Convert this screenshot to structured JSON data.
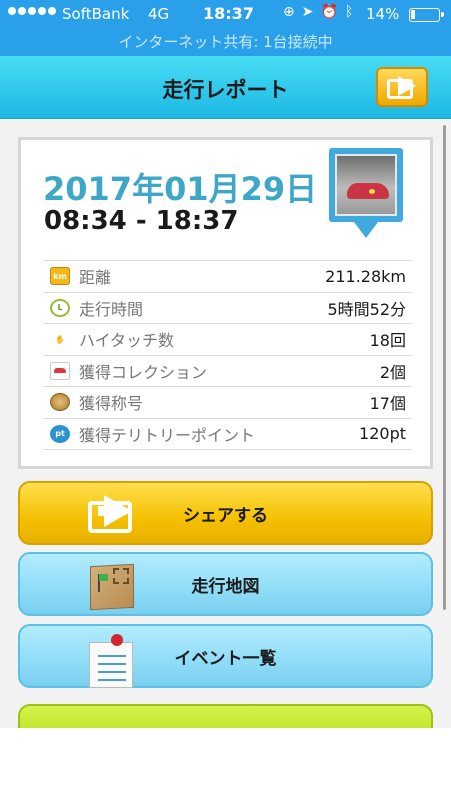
{
  "status_bar": {
    "carrier": "SoftBank",
    "network": "4G",
    "time": "18:37",
    "battery": "14%",
    "icons": [
      "orientation-lock-icon",
      "location-arrow-icon",
      "alarm-icon",
      "bluetooth-icon",
      "battery-icon"
    ]
  },
  "hotspot_banner": "インターネット共有: 1台接続中",
  "header": {
    "title": "走行レポート",
    "share_icon": "share-icon"
  },
  "report": {
    "date": "2017年01月29日",
    "time_range": "08:34 - 18:37",
    "stats": [
      {
        "icon": "km-icon",
        "icon_text": "km",
        "label": "距離",
        "value": "211.28km"
      },
      {
        "icon": "clock-icon",
        "icon_text": "L",
        "label": "走行時間",
        "value": "5時間52分"
      },
      {
        "icon": "high-touch-hand-icon",
        "icon_text": "✋",
        "label": "ハイタッチ数",
        "value": "18回"
      },
      {
        "icon": "car-collection-icon",
        "icon_text": "",
        "label": "獲得コレクション",
        "value": "2個"
      },
      {
        "icon": "medal-icon",
        "icon_text": "",
        "label": "獲得称号",
        "value": "17個"
      },
      {
        "icon": "territory-point-icon",
        "icon_text": "pt",
        "label": "獲得テリトリーポイント",
        "value": "120pt"
      }
    ]
  },
  "buttons": {
    "share": "シェアする",
    "map": "走行地図",
    "events": "イベント一覧"
  },
  "colors": {
    "status_bar": "#2aa0ea",
    "header": "#1db7e2",
    "date_text": "#3ea7c9",
    "share_button": "#f4c000",
    "blue_button": "#8fdcf7",
    "green_button": "#b6e021"
  }
}
